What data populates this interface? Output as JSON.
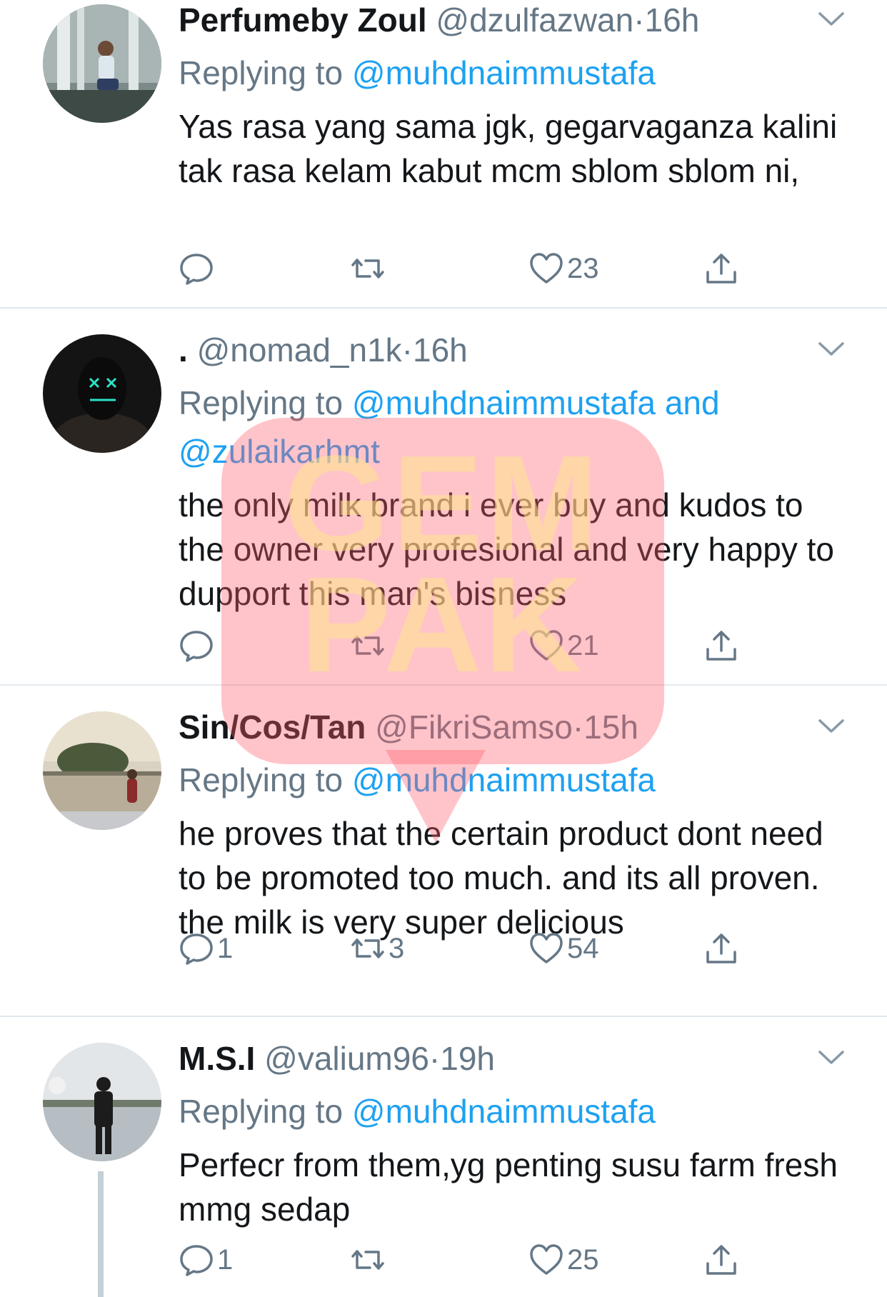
{
  "colors": {
    "link": "#1da1f2",
    "muted": "#657786",
    "text": "#14171a",
    "divider": "#e1e8ed"
  },
  "icons": {
    "reply": "reply-icon",
    "retweet": "retweet-icon",
    "like": "heart-icon",
    "share": "share-icon",
    "more": "chevron-down-icon"
  },
  "watermark": {
    "text_line1": "GEM",
    "text_line2": "PAK"
  },
  "tweets": [
    {
      "name": "Perfumeby Zoul",
      "handle": "@dzulfazwan",
      "separator": "·",
      "time": "16h",
      "replying_prefix": "Replying to",
      "replying_to": "@muhdnaimmustafa",
      "text": "Yas rasa yang sama jgk, gegarvaganza kalini tak rasa kelam kabut mcm sblom sblom ni,",
      "replies": "",
      "retweets": "",
      "likes": "23"
    },
    {
      "name": ".",
      "handle": "@nomad_n1k",
      "separator": "·",
      "time": "16h",
      "replying_prefix": "Replying to",
      "replying_to": "@muhdnaimmustafa",
      "replying_and": "and",
      "replying_to_2": "@zulaikarhmt",
      "text": "the only milk brand i ever buy and kudos to the owner very profesional and very happy to dupport this man's bisness",
      "replies": "",
      "retweets": "",
      "likes": "21"
    },
    {
      "name": "Sin/Cos/Tan",
      "handle": "@FikriSamso",
      "separator": "·",
      "time": "15h",
      "replying_prefix": "Replying to",
      "replying_to": "@muhdnaimmustafa",
      "text": "he proves that the certain  product  dont need to be promoted too much. and its all proven. the milk is very super delicious",
      "replies": "1",
      "retweets": "3",
      "likes": "54"
    },
    {
      "name": "M.S.I",
      "handle": "@valium96",
      "separator": "·",
      "time": "19h",
      "replying_prefix": "Replying to",
      "replying_to": "@muhdnaimmustafa",
      "text": "Perfecr from them,yg penting susu farm fresh mmg sedap",
      "replies": "1",
      "retweets": "",
      "likes": "25"
    }
  ]
}
